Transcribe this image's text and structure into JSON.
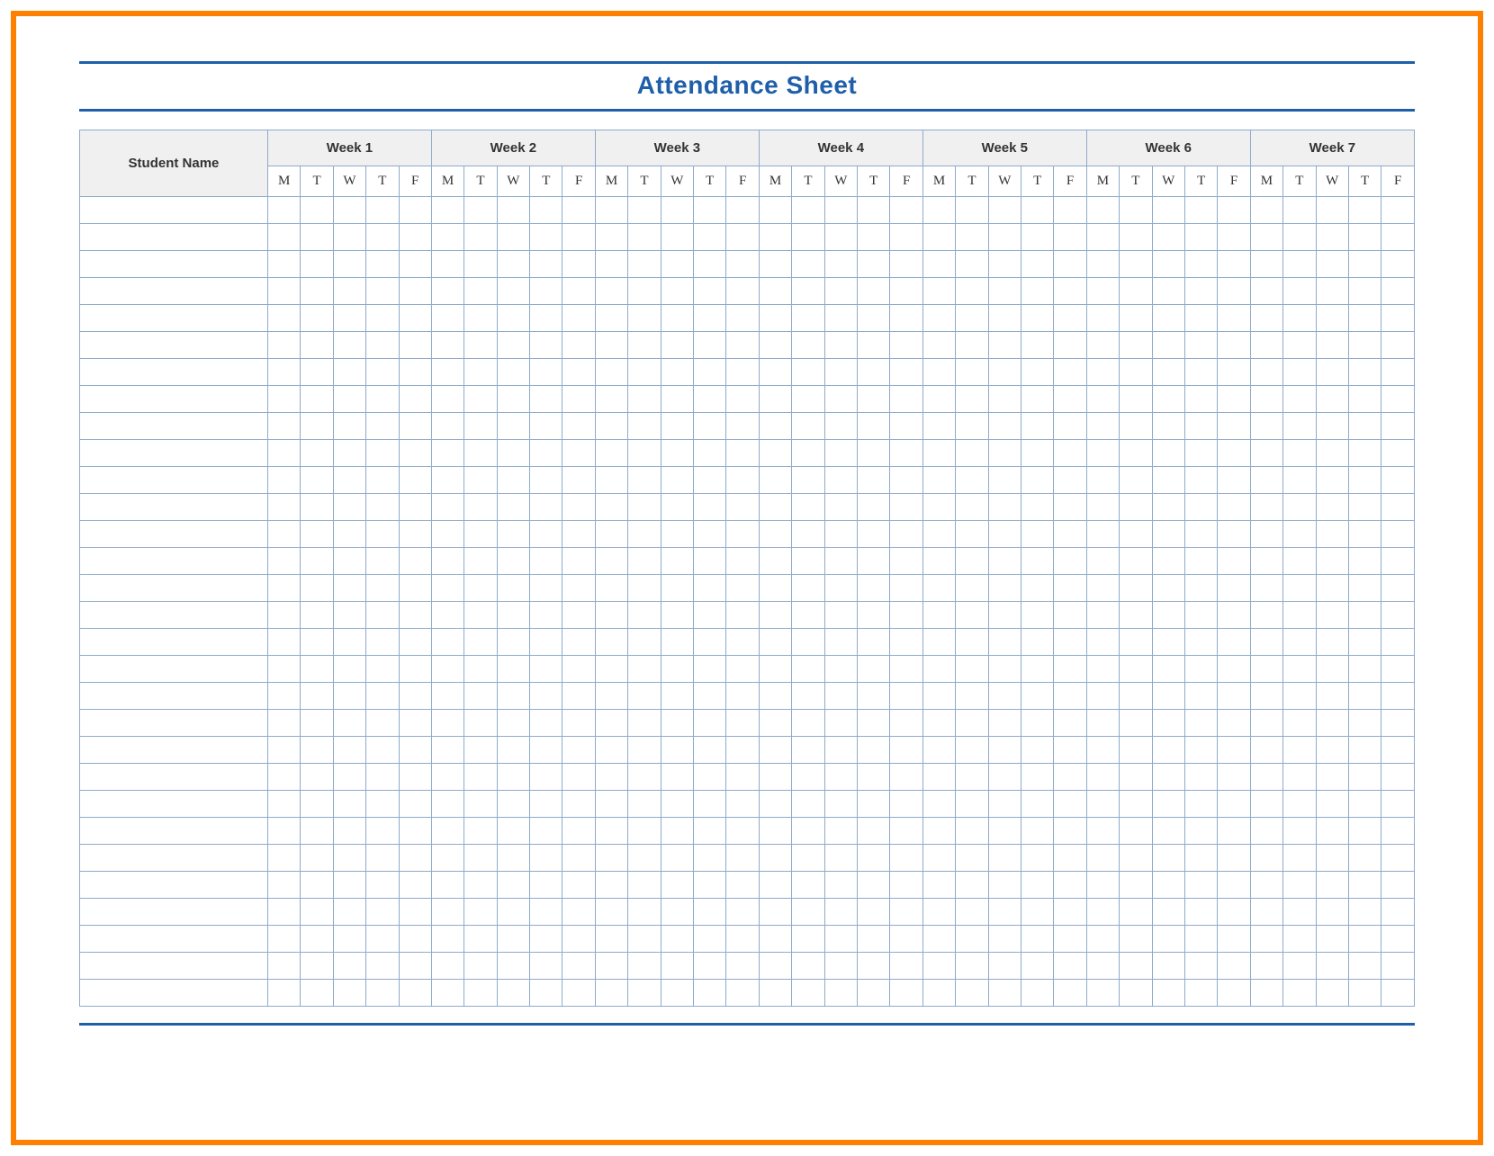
{
  "title": "Attendance Sheet",
  "columns": {
    "student_name": "Student Name",
    "weeks": [
      "Week 1",
      "Week 2",
      "Week 3",
      "Week 4",
      "Week 5",
      "Week 6",
      "Week 7"
    ],
    "days": [
      "M",
      "T",
      "W",
      "T",
      "F"
    ]
  },
  "row_count": 30,
  "colors": {
    "frame_border": "#ff7f00",
    "rule": "#1f5fa9",
    "title": "#1f5fa9",
    "grid_border": "#8faacb",
    "header_bg": "#f0f0f0"
  }
}
